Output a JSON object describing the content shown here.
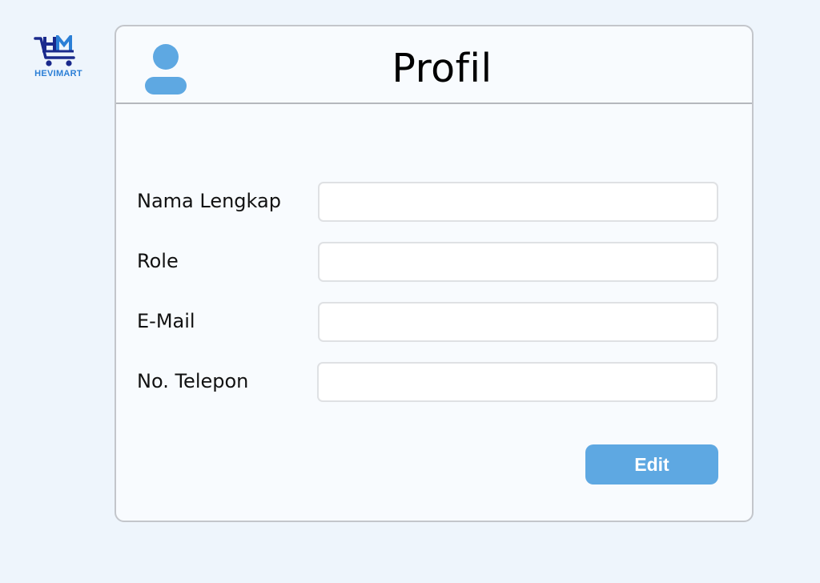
{
  "brand": {
    "logo_text": "HEVIMART",
    "colors": {
      "dark": "#1a2a8c",
      "light": "#2b7fd6"
    }
  },
  "profile": {
    "title": "Profil",
    "avatar_icon": "user-icon",
    "fields": [
      {
        "label": "Nama Lengkap",
        "value": "",
        "placeholder": ""
      },
      {
        "label": "Role",
        "value": "",
        "placeholder": ""
      },
      {
        "label": "E-Mail",
        "value": "",
        "placeholder": ""
      },
      {
        "label": "No. Telepon",
        "value": "",
        "placeholder": ""
      }
    ],
    "edit_label": "Edit"
  },
  "colors": {
    "accent": "#5ea8e2",
    "background": "#eef5fc",
    "card": "#f8fbfe"
  }
}
